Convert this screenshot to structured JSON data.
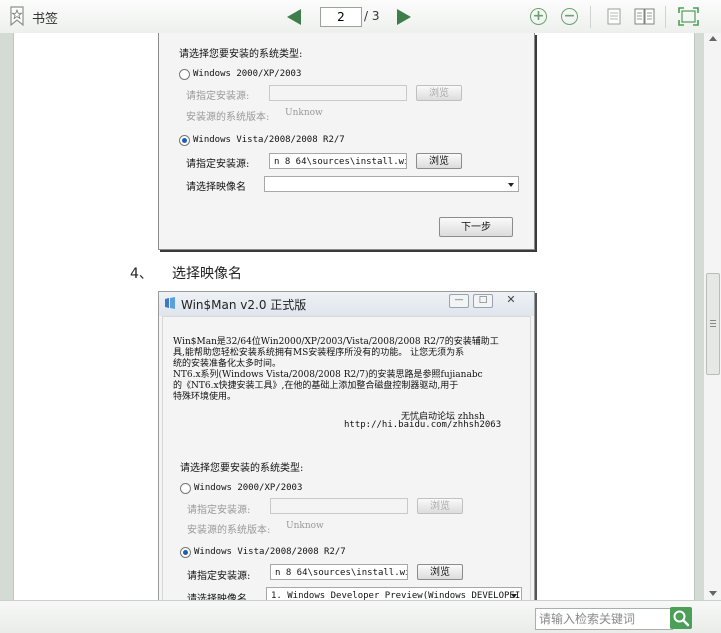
{
  "toolbar": {
    "bookmark_label": "书签",
    "current_page": "2",
    "total_pages": "/ 3"
  },
  "doc": {
    "dialog1": {
      "heading": "请选择您要安装的系统类型:",
      "opt_xp": "Windows 2000/XP/2003",
      "src_label_gray": "请指定安装源:",
      "browse_gray": "浏览",
      "version_label": "安装源的系统版本:",
      "version_value": "Unknow",
      "opt_vista": "Windows Vista/2008/2008 R2/7",
      "src_label": "请指定安装源:",
      "src_value": "n 8 64\\sources\\install.wim",
      "browse": "浏览",
      "image_label": "请选择映像名",
      "next": "下一步"
    },
    "step_num": "4、",
    "step_text": "选择映像名",
    "dialog2": {
      "title": "Win$Man v2.0 正式版",
      "intro1": "Win$Man是32/64位Win2000/XP/2003/Vista/2008/2008 R2/7的安装辅助工",
      "intro2": "具,能帮助您轻松安装系统拥有MS安装程序所没有的功能。 让您无须为系",
      "intro3": "统的安装准备化太多时间。",
      "intro4": "NT6.x系列(Windows Vista/2008/2008 R2/7)的安装思路是参照fujianabc",
      "intro5": "的《NT6.x快捷安装工具》,在他的基础上添加整合磁盘控制器驱动,用于",
      "intro6": "特殊环境使用。",
      "forum": "无忧启动论坛 zhhsh",
      "url": "http://hi.baidu.com/zhhsh2063",
      "heading": "请选择您要安装的系统类型:",
      "opt_xp": "Windows 2000/XP/2003",
      "src_label_gray": "请指定安装源:",
      "browse_gray": "浏览",
      "version_label": "安装源的系统版本:",
      "version_value": "Unknow",
      "opt_vista": "Windows Vista/2008/2008 R2/7",
      "src_label": "请指定安装源:",
      "src_value": "n 8 64\\sources\\install.wim",
      "browse": "浏览",
      "image_label": "请选择映像名",
      "image_value": "1. Windows Developer Preview(Windows DEVELOPEI"
    }
  },
  "search": {
    "placeholder": "请输入检索关键词"
  },
  "colors": {
    "accent": "#4b9f58",
    "nav_arrow": "#3f7d4a"
  }
}
